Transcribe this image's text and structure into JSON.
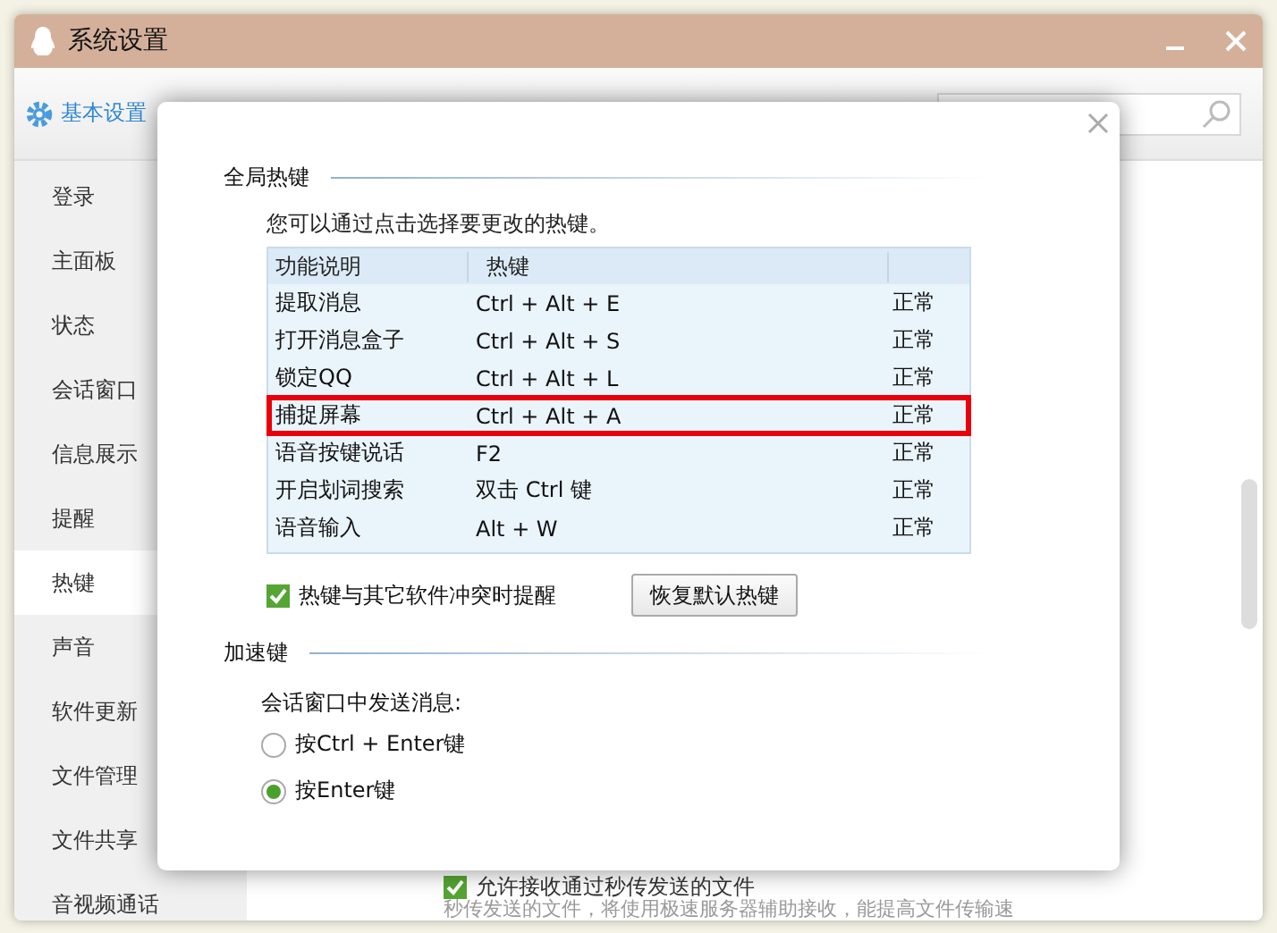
{
  "window": {
    "title": "系统设置"
  },
  "tabs": [
    {
      "label": "基本设置",
      "selected": true
    }
  ],
  "sidebar": {
    "items": [
      {
        "label": "登录",
        "selected": false
      },
      {
        "label": "主面板",
        "selected": false
      },
      {
        "label": "状态",
        "selected": false
      },
      {
        "label": "会话窗口",
        "selected": false
      },
      {
        "label": "信息展示",
        "selected": false
      },
      {
        "label": "提醒",
        "selected": false
      },
      {
        "label": "热键",
        "selected": true
      },
      {
        "label": "声音",
        "selected": false
      },
      {
        "label": "软件更新",
        "selected": false
      },
      {
        "label": "文件管理",
        "selected": false
      },
      {
        "label": "文件共享",
        "selected": false
      },
      {
        "label": "音视频通话",
        "selected": false
      }
    ]
  },
  "background_content": {
    "checkbox": {
      "label": "允许接收通过秒传发送的文件",
      "checked": true
    },
    "note": "秒传发送的文件，将使用极速服务器辅助接收，能提高文件传输速"
  },
  "dialog": {
    "global_hotkeys": {
      "title": "全局热键",
      "description": "您可以通过点击选择要更改的热键。",
      "columns": [
        "功能说明",
        "热键"
      ],
      "rows": [
        {
          "function": "提取消息",
          "hotkey": "Ctrl + Alt + E",
          "status": "正常",
          "highlighted": false
        },
        {
          "function": "打开消息盒子",
          "hotkey": "Ctrl + Alt + S",
          "status": "正常",
          "highlighted": false
        },
        {
          "function": "锁定QQ",
          "hotkey": "Ctrl + Alt + L",
          "status": "正常",
          "highlighted": false
        },
        {
          "function": "捕捉屏幕",
          "hotkey": "Ctrl + Alt + A",
          "status": "正常",
          "highlighted": true
        },
        {
          "function": "语音按键说话",
          "hotkey": "F2",
          "status": "正常",
          "highlighted": false
        },
        {
          "function": "开启划词搜索",
          "hotkey": "双击 Ctrl 键",
          "status": "正常",
          "highlighted": false
        },
        {
          "function": "语音输入",
          "hotkey": "Alt + W",
          "status": "正常",
          "highlighted": false
        }
      ],
      "conflict_alert": {
        "label": "热键与其它软件冲突时提醒",
        "checked": true
      },
      "restore_button": "恢复默认热键"
    },
    "accelerator": {
      "title": "加速键",
      "prompt": "会话窗口中发送消息:",
      "options": [
        {
          "label": "按Ctrl + Enter键",
          "selected": false
        },
        {
          "label": "按Enter键",
          "selected": true
        }
      ]
    }
  }
}
